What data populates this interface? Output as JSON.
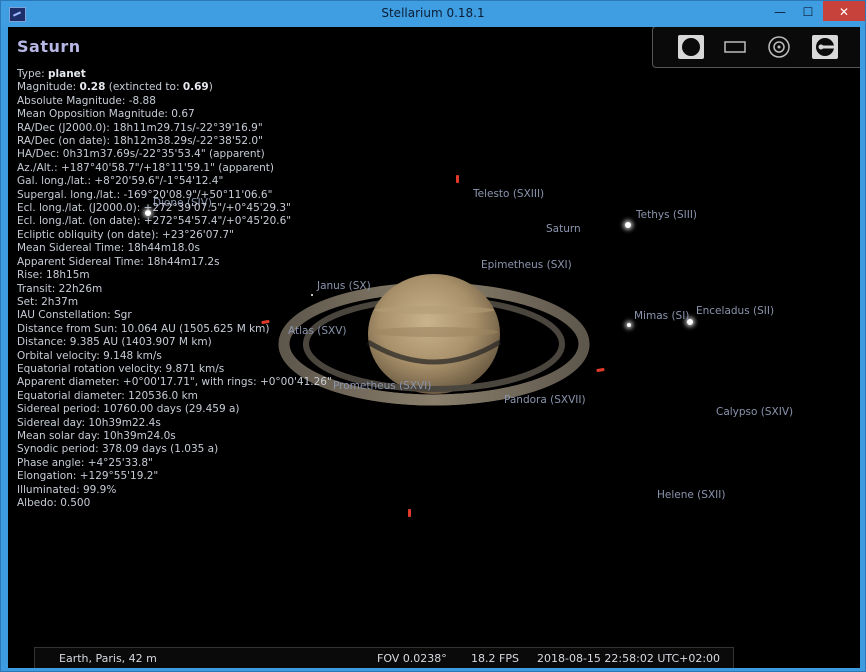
{
  "window": {
    "title": "Stellarium 0.18.1",
    "min_label": "—",
    "max_label": "☐",
    "close_label": "✕"
  },
  "info": {
    "name": "Saturn",
    "type_label": "Type: ",
    "type_value": "planet",
    "magnitude_label": "Magnitude: ",
    "magnitude_value": "0.28",
    "extincted_label": " (extincted to: ",
    "extincted_value": "0.69",
    "extincted_end": ")",
    "lines": [
      "Absolute Magnitude: -8.88",
      "Mean Opposition Magnitude: 0.67",
      "RA/Dec (J2000.0): 18h11m29.71s/-22°39'16.9\"",
      "RA/Dec (on date): 18h12m38.29s/-22°38'52.0\"",
      "HA/Dec: 0h31m37.69s/-22°35'53.4\" (apparent)",
      "Az./Alt.: +187°40'58.7\"/+18°11'59.1\" (apparent)",
      "Gal. long./lat.: +8°20'59.6\"/-1°54'12.4\"",
      "Supergal. long./lat.: -169°20'08.9\"/+50°11'06.6\"",
      "Ecl. long./lat. (J2000.0): +272°39'07.5\"/+0°45'29.3\"",
      "Ecl. long./lat. (on date): +272°54'57.4\"/+0°45'20.6\"",
      "Ecliptic obliquity (on date): +23°26'07.7\"",
      "Mean Sidereal Time: 18h44m18.0s",
      "Apparent Sidereal Time: 18h44m17.2s",
      "Rise: 18h15m",
      "Transit: 22h26m",
      "Set: 2h37m",
      "IAU Constellation: Sgr",
      "Distance from Sun: 10.064 AU (1505.625 M km)",
      "Distance: 9.385 AU (1403.907 M km)",
      "Orbital velocity: 9.148 km/s",
      "Equatorial rotation velocity: 9.871 km/s",
      "Apparent diameter: +0°00'17.71\", with rings: +0°00'41.26\"",
      "Equatorial diameter: 120536.0 km",
      "Sidereal period: 10760.00 days (29.459 a)",
      "Sidereal day: 10h39m22.4s",
      "Mean solar day: 10h39m24.0s",
      "Synodic period: 378.09 days (1.035 a)",
      "Phase angle: +4°25'33.8\"",
      "Elongation: +129°55'19.2\"",
      "Illuminated: 99.9%",
      "Albedo: 0.500"
    ]
  },
  "sky_labels": {
    "telesto": "Telesto (SXIII)",
    "tethys": "Tethys (SIII)",
    "saturn": "Saturn",
    "dione": "Dione (SIV)",
    "epimetheus": "Epimetheus (SXI)",
    "janus": "Janus (SX)",
    "mimas": "Mimas (SI)",
    "enceladus": "Enceladus (SII)",
    "atlas": "Atlas (SXV)",
    "prometheus": "Prometheus (SXVI)",
    "pandora": "Pandora (SXVII)",
    "calypso": "Calypso (SXIV)",
    "helene": "Helene (SXII)"
  },
  "toolbar": {
    "icons": [
      "full-disk-icon",
      "rectangle-frame-icon",
      "target-circle-icon",
      "telescope-icon"
    ]
  },
  "status": {
    "location": "Earth, Paris, 42 m",
    "fov": "FOV 0.0238°",
    "fps": "18.2 FPS",
    "datetime": "2018-08-15 22:58:02 UTC+02:00"
  },
  "colors": {
    "planet_label": "#b7b7e6",
    "hint_marker": "#e23a2a",
    "moon_label": "#8a94ad"
  }
}
